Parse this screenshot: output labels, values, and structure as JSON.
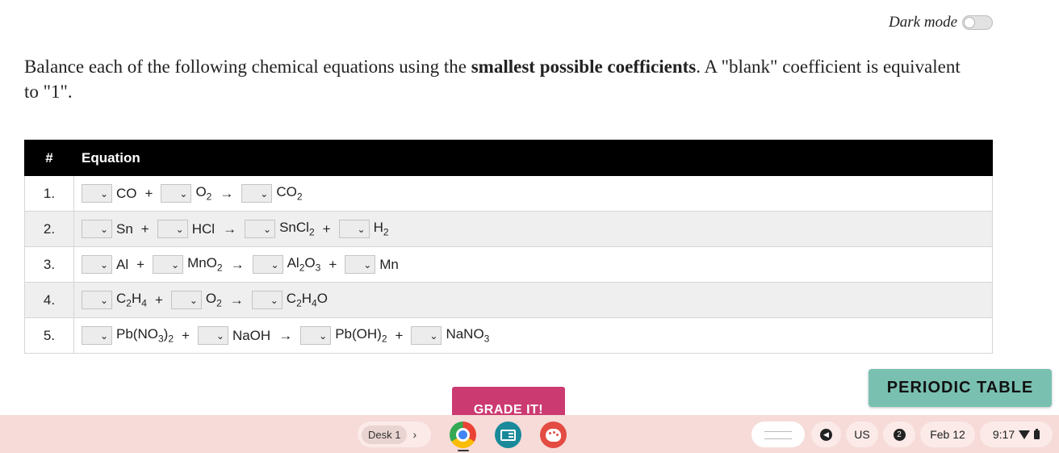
{
  "dark_mode": {
    "label": "Dark mode",
    "enabled": false
  },
  "instructions": {
    "before": "Balance each of the following chemical equations using the ",
    "bold": "smallest possible coefficients",
    "after": ". A \"blank\" coefficient is equivalent to \"1\"."
  },
  "table": {
    "headers": [
      "#",
      "Equation"
    ],
    "rows": [
      {
        "num": "1.",
        "terms": [
          {
            "t": "sp",
            "v": "CO"
          },
          {
            "t": "op",
            "v": "+"
          },
          {
            "t": "sp",
            "v": "O<sub>2</sub>"
          },
          {
            "t": "op",
            "v": "→"
          },
          {
            "t": "sp",
            "v": "CO<sub>2</sub>"
          }
        ]
      },
      {
        "num": "2.",
        "terms": [
          {
            "t": "sp",
            "v": "Sn"
          },
          {
            "t": "op",
            "v": "+"
          },
          {
            "t": "sp",
            "v": "HCl"
          },
          {
            "t": "op",
            "v": "→"
          },
          {
            "t": "sp",
            "v": "SnCl<sub>2</sub>"
          },
          {
            "t": "op",
            "v": "+"
          },
          {
            "t": "sp",
            "v": "H<sub>2</sub>"
          }
        ]
      },
      {
        "num": "3.",
        "terms": [
          {
            "t": "sp",
            "v": "Al"
          },
          {
            "t": "op",
            "v": "+"
          },
          {
            "t": "sp",
            "v": "MnO<sub>2</sub>"
          },
          {
            "t": "op",
            "v": "→"
          },
          {
            "t": "sp",
            "v": "Al<sub>2</sub>O<sub>3</sub>"
          },
          {
            "t": "op",
            "v": "+"
          },
          {
            "t": "sp",
            "v": "Mn"
          }
        ]
      },
      {
        "num": "4.",
        "terms": [
          {
            "t": "sp",
            "v": "C<sub>2</sub>H<sub>4</sub>"
          },
          {
            "t": "op",
            "v": "+"
          },
          {
            "t": "sp",
            "v": "O<sub>2</sub>"
          },
          {
            "t": "op",
            "v": "→"
          },
          {
            "t": "sp",
            "v": "C<sub>2</sub>H<sub>4</sub>O"
          }
        ]
      },
      {
        "num": "5.",
        "terms": [
          {
            "t": "sp",
            "v": "Pb(NO<sub>3</sub>)<sub>2</sub>"
          },
          {
            "t": "op",
            "v": "+"
          },
          {
            "t": "sp",
            "v": "NaOH"
          },
          {
            "t": "op",
            "v": "→"
          },
          {
            "t": "sp",
            "v": "Pb(OH)<sub>2</sub>"
          },
          {
            "t": "op",
            "v": "+"
          },
          {
            "t": "sp",
            "v": "NaNO<sub>3</sub>"
          }
        ]
      }
    ]
  },
  "grade_button": "GRADE IT!",
  "periodic_button": "PERIODIC TABLE",
  "shelf": {
    "desk_label": "Desk 1",
    "apps": [
      "chrome-icon",
      "classroom-icon",
      "palette-icon"
    ],
    "ime": "US",
    "notification_count": "2",
    "date": "Feb 12",
    "time": "9:17"
  },
  "colors": {
    "header_bg": "#000000",
    "grade_button": "#cc3a72",
    "periodic_button": "#79c0b1",
    "shelf_bg": "#f6dbd8"
  }
}
